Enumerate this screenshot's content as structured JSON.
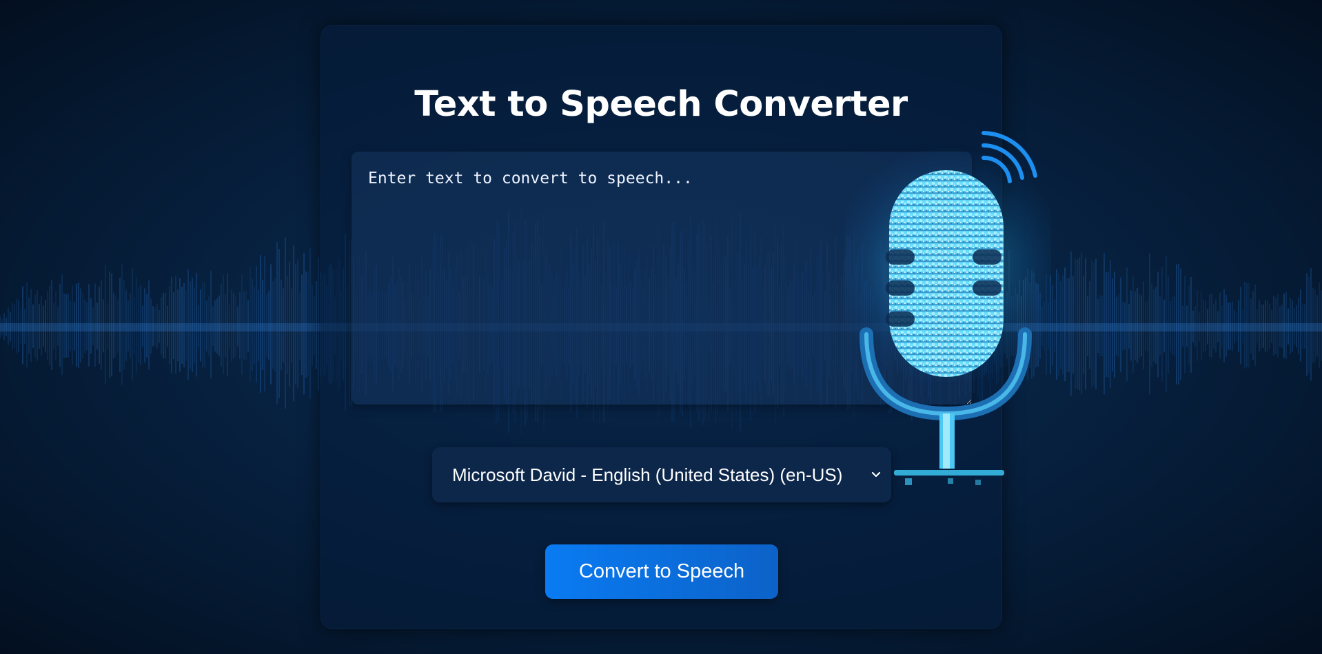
{
  "header": {
    "title": "Text to Speech Converter"
  },
  "input": {
    "value": "",
    "placeholder": "Enter text to convert to speech..."
  },
  "voice_select": {
    "selected": "Microsoft David - English (United States) (en-US)"
  },
  "actions": {
    "convert_label": "Convert to Speech"
  },
  "icons": {
    "microphone": "microphone-icon",
    "signal": "signal-waves-icon",
    "dropdown": "chevron-down-icon"
  },
  "colors": {
    "background": "#051a33",
    "card": "#0a2648",
    "accent": "#0a7bf2",
    "mic_glow": "#3ad6ff",
    "wave": "#1f5fa8"
  }
}
